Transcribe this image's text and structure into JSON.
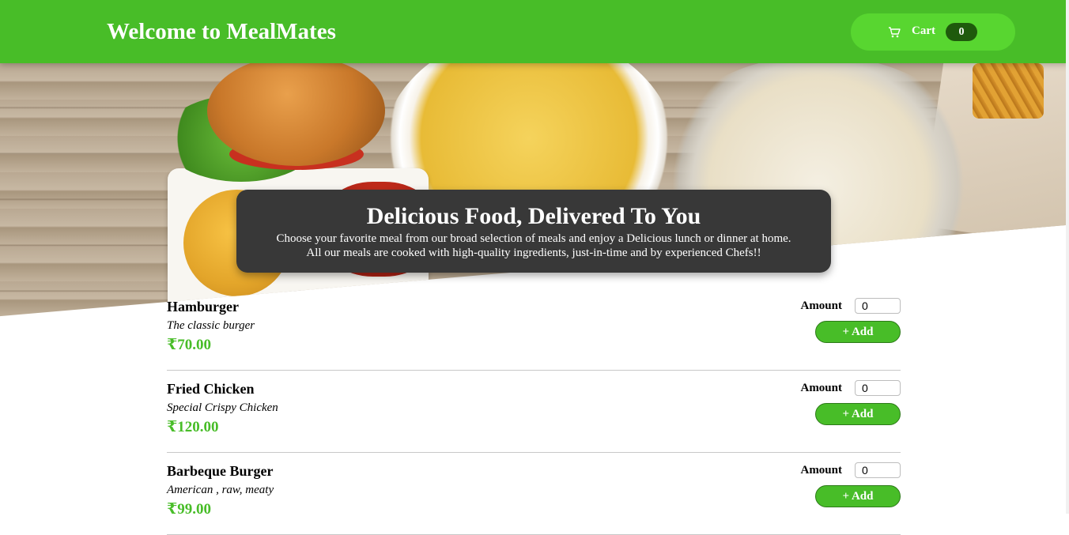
{
  "header": {
    "title": "Welcome to MealMates",
    "cart_label": "Cart",
    "cart_count": "0",
    "cart_icon": "cart-icon",
    "brand_color": "#48bd28",
    "cart_button_color": "#58d630",
    "badge_color": "#1f5a0c"
  },
  "hero": {
    "title": "Delicious Food, Delivered To You",
    "line1": "Choose your favorite meal from our broad selection of meals and enjoy a Delicious lunch or dinner at home.",
    "line2": "All our meals are cooked with high-quality ingredients, just-in-time and by experienced Chefs!!"
  },
  "meals": [
    {
      "name": "Hamburger",
      "description": "The classic burger",
      "price": "₹70.00",
      "amount_label": "Amount",
      "amount_value": "0",
      "add_label": "+ Add"
    },
    {
      "name": "Fried Chicken",
      "description": "Special Crispy Chicken",
      "price": "₹120.00",
      "amount_label": "Amount",
      "amount_value": "0",
      "add_label": "+ Add"
    },
    {
      "name": "Barbeque Burger",
      "description": "American , raw, meaty",
      "price": "₹99.00",
      "amount_label": "Amount",
      "amount_value": "0",
      "add_label": "+ Add"
    }
  ]
}
